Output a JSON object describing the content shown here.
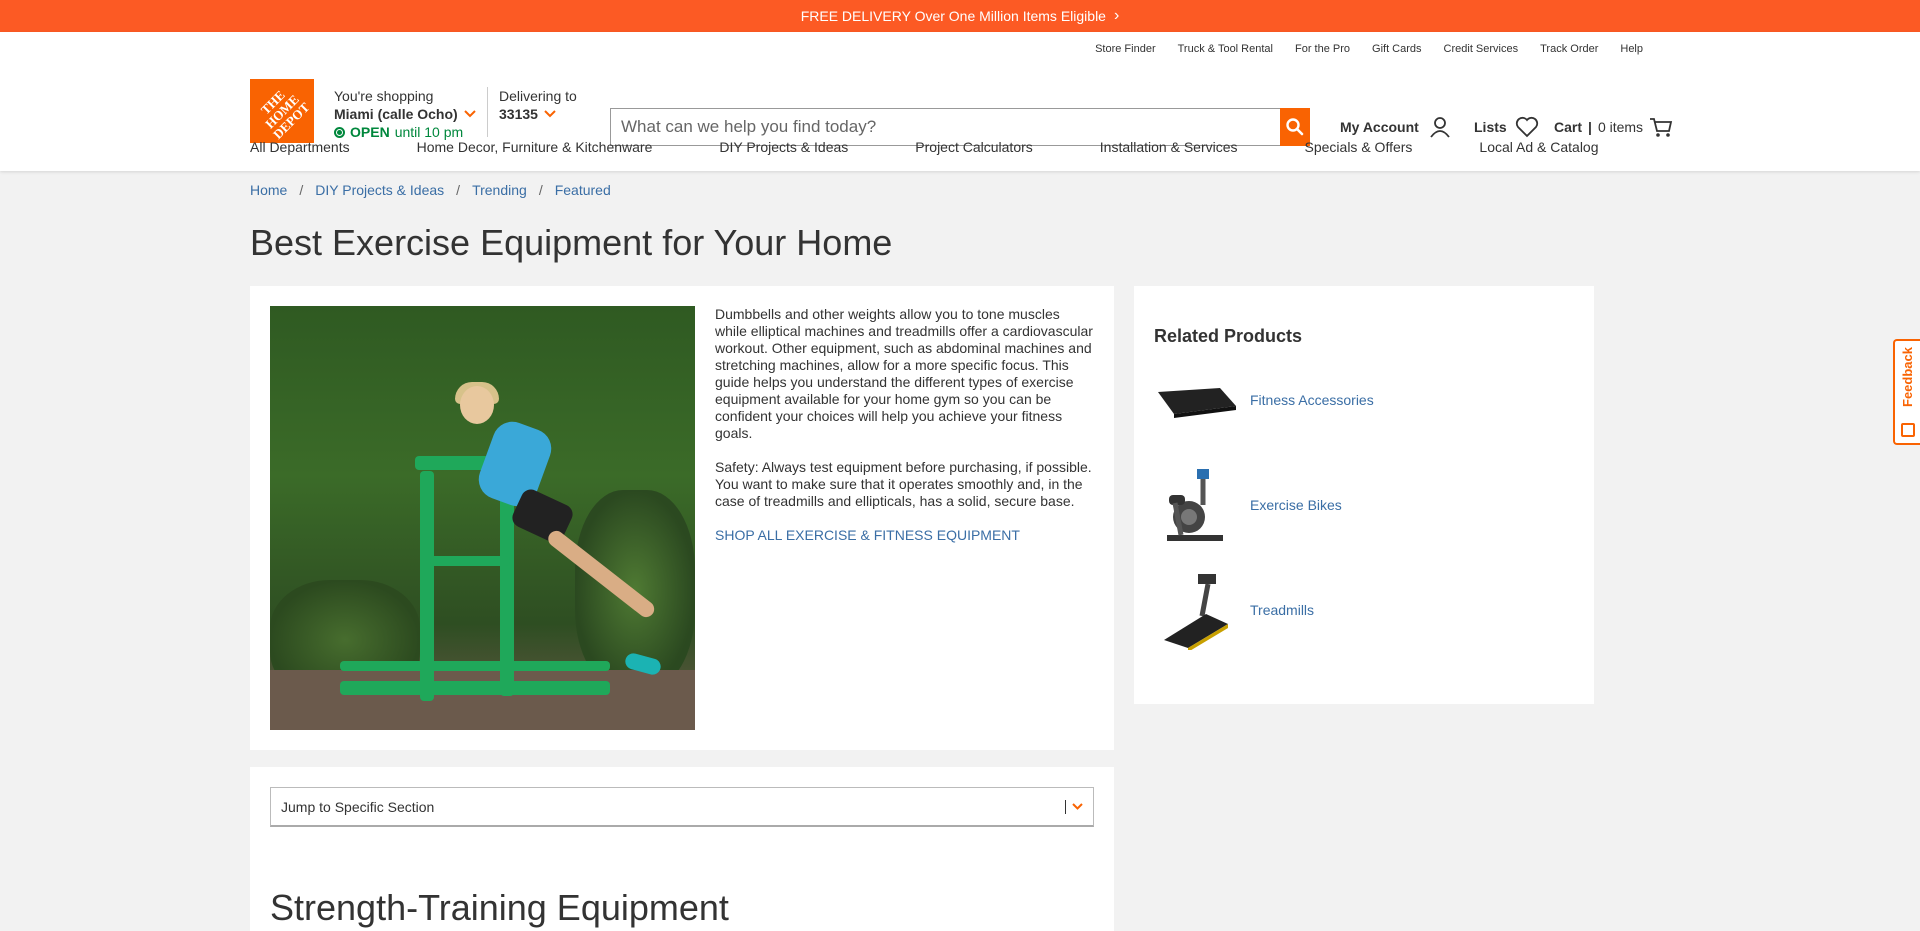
{
  "promo": {
    "text": "FREE DELIVERY Over One Million Items Eligible",
    "chevron": "›"
  },
  "utility_links": [
    "Store Finder",
    "Truck & Tool Rental",
    "For the Pro",
    "Gift Cards",
    "Credit Services",
    "Track Order",
    "Help"
  ],
  "logo": {
    "text": "THE HOME DEPOT"
  },
  "store": {
    "shopping_label": "You're shopping",
    "name": "Miami (calle Ocho)",
    "open_label": "OPEN",
    "hours": "until 10 pm"
  },
  "delivery": {
    "label": "Delivering to",
    "zip": "33135"
  },
  "search": {
    "placeholder": "What can we help you find today?"
  },
  "account": {
    "label": "My Account"
  },
  "lists": {
    "label": "Lists"
  },
  "cart": {
    "label": "Cart",
    "separator": " | ",
    "count": "0 items"
  },
  "nav": [
    "All Departments",
    "Home Decor, Furniture & Kitchenware",
    "DIY Projects & Ideas",
    "Project Calculators",
    "Installation & Services",
    "Specials & Offers",
    "Local Ad & Catalog"
  ],
  "breadcrumb": [
    "Home",
    "DIY Projects & Ideas",
    "Trending",
    "Featured"
  ],
  "breadcrumb_sep": "/",
  "page_title": "Best Exercise Equipment for Your Home",
  "article": {
    "paragraph1": "Dumbbells and other weights allow you to tone muscles while elliptical machines and treadmills offer a cardiovascular workout. Other equipment, such as abdominal machines and stretching machines, allow for a more specific focus. This guide helps you understand the different types of exercise equipment available for your home gym so you can be confident your choices will help you achieve your fitness goals.",
    "paragraph2": "Safety: Always test equipment before purchasing, if possible. You want to make sure that it operates smoothly and, in the case of treadmills and ellipticals, has a solid, secure base.",
    "shop_link": "SHOP ALL EXERCISE & FITNESS EQUIPMENT"
  },
  "related": {
    "title": "Related Products",
    "items": [
      {
        "label": "Fitness Accessories",
        "icon": "exercise-mat-icon"
      },
      {
        "label": "Exercise Bikes",
        "icon": "exercise-bike-icon"
      },
      {
        "label": "Treadmills",
        "icon": "treadmill-icon"
      }
    ]
  },
  "jump": {
    "label": "Jump to Specific Section"
  },
  "section_title": "Strength-Training Equipment",
  "feedback": {
    "label": "Feedback"
  },
  "colors": {
    "brand_orange": "#f96302",
    "promo_orange": "#fc5a24",
    "link_blue": "#3a6ea5",
    "open_green": "#00873c"
  }
}
